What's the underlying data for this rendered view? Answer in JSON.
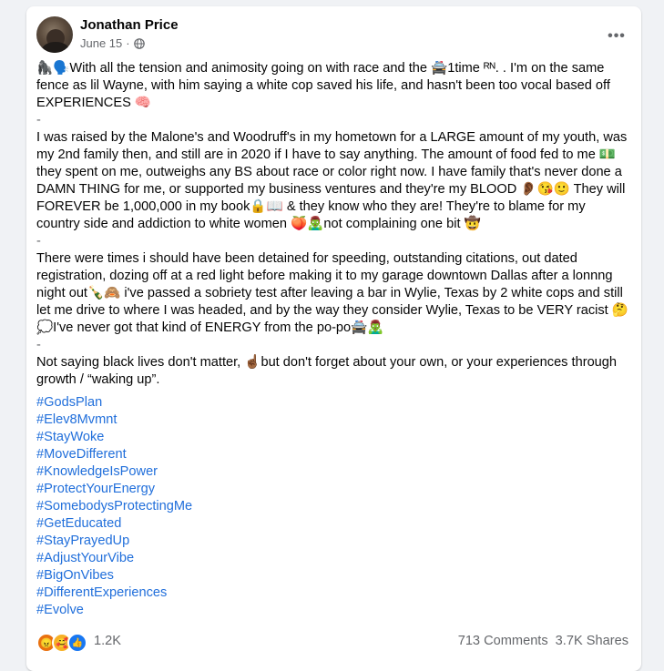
{
  "post": {
    "author": "Jonathan Price",
    "date": "June 15",
    "date_sep": "·",
    "more_icon": "•••",
    "paragraphs": [
      "🦍🗣️With all the tension and animosity going on with race and the 🚔1time ᴿᴺ. . I'm on the same fence as lil Wayne, with him saying a white cop saved his life, and hasn't been too vocal based off EXPERIENCES 🧠",
      "-",
      "I was raised by the Malone's and Woodruff's in my hometown for a LARGE amount of my youth, was my 2nd family then, and still are in 2020 if I have to say anything. The amount of food fed to me 💵 they spent on me, outweighs any BS about race or color right now. I have family that's never done a DAMN THING for me, or supported my business ventures and they're my BLOOD 👂🏾😘🙂 They will FOREVER be 1,000,000 in my book🔒📖 & they know who they are! They're to blame for my country side and addiction to white women 🍑🧟‍♂️not complaining one bit 🤠",
      "-",
      "There were times i should have been detained for speeding, outstanding citations, out dated registration, dozing off at a red light before making it to my garage downtown  Dallas after a lonnng night out🍾🙈 i've passed a sobriety test after leaving a bar in Wylie, Texas by 2 white cops and still let me drive to where I was headed, and by the way they consider Wylie, Texas to be VERY racist 🤔💭I've never got that kind of ENERGY from the po-po🚔🧟‍♂️",
      "-",
      "Not saying black lives don't matter, ☝🏾but don't forget about your own, or your experiences through growth / “waking up”."
    ],
    "hashtags": [
      "#GodsPlan",
      "#Elev8Mvmnt",
      "#StayWoke",
      "#MoveDifferent",
      "#KnowledgeIsPower",
      "#ProtectYourEnergy",
      "#SomebodysProtectingMe",
      "#GetEducated",
      "#StayPrayedUp",
      "#AdjustYourVibe",
      "#BigOnVibes",
      "#DifferentExperiences",
      "#Evolve"
    ],
    "reactions": {
      "count": "1.2K",
      "icons": [
        "angry-icon",
        "care-icon",
        "like-icon"
      ]
    },
    "comments": "713 Comments",
    "shares": "3.7K Shares"
  },
  "colors": {
    "background": "#f0f2f5",
    "card": "#ffffff",
    "hashtag": "#216fdb",
    "secondary_text": "#65676b",
    "like": "#1877f2"
  }
}
